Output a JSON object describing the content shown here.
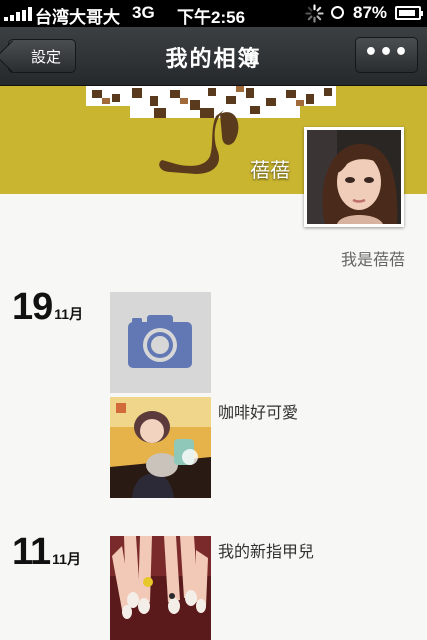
{
  "status_bar": {
    "carrier": "台湾大哥大",
    "network": "3G",
    "time": "下午2:56",
    "battery_percent": "87%",
    "battery_level": 0.87
  },
  "nav": {
    "back_label": "設定",
    "title": "我的相簿",
    "more_label": "•••"
  },
  "profile": {
    "name": "蓓蓓",
    "signature": "我是蓓蓓"
  },
  "entries": [
    {
      "day": "19",
      "month": "11月",
      "caption": ""
    },
    {
      "day": "",
      "month": "",
      "caption": "咖啡好可愛"
    },
    {
      "day": "11",
      "month": "11月",
      "caption": "我的新指甲兒"
    }
  ],
  "colors": {
    "cover": "#c9b52f",
    "camera_blue": "#6178b4"
  },
  "icons": [
    "camera-icon",
    "signal-icon",
    "loading-spinner-icon",
    "clock-icon",
    "battery-icon"
  ]
}
